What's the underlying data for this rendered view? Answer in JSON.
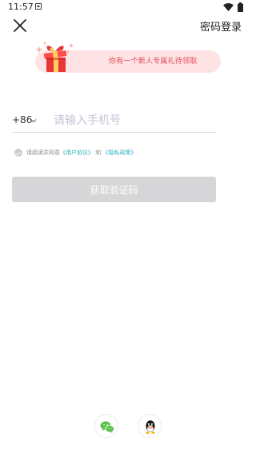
{
  "status": {
    "time": "11:57"
  },
  "header": {
    "password_login": "密码登录"
  },
  "gift": {
    "text": "你有一个新人专属礼待领取"
  },
  "phone": {
    "country_code": "+86",
    "placeholder": "请输入手机号"
  },
  "agreement": {
    "prefix": "请阅读并同意",
    "user_agreement": "《用户协议》",
    "and": "和",
    "privacy_policy": "《隐私政策》"
  },
  "actions": {
    "get_code": "获取验证码"
  },
  "social": {
    "icons": [
      "wechat-icon",
      "qq-icon"
    ]
  },
  "colors": {
    "accent": "#2bb3b8",
    "gift_text": "#e84b5b",
    "button_disabled": "#d6d6d9"
  }
}
